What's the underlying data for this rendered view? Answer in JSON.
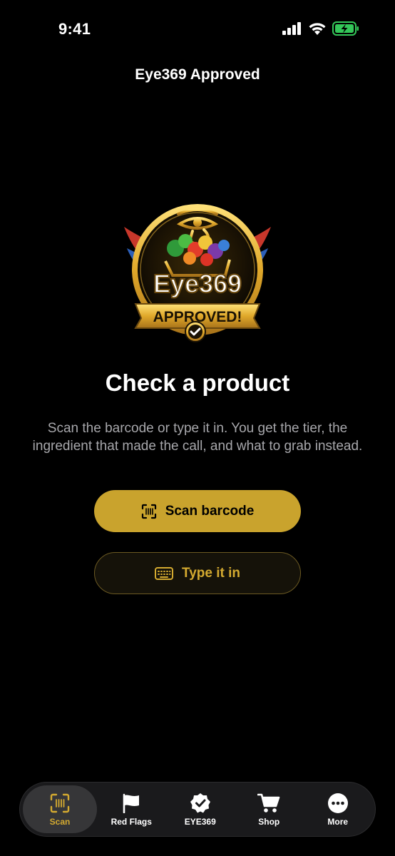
{
  "status_bar": {
    "time": "9:41"
  },
  "header": {
    "title": "Eye369 Approved"
  },
  "logo": {
    "brand": "Eye369",
    "banner": "APPROVED!"
  },
  "main": {
    "heading": "Check a product",
    "description": "Scan the barcode or type it in. You get the tier, the ingredient that made the call, and what to grab instead.",
    "scan_button": "Scan barcode",
    "type_button": "Type it in"
  },
  "tabs": [
    {
      "label": "Scan",
      "icon": "barcode-scan-icon",
      "active": true
    },
    {
      "label": "Red Flags",
      "icon": "flag-icon"
    },
    {
      "label": "EYE369",
      "icon": "verified-badge-icon"
    },
    {
      "label": "Shop",
      "icon": "cart-icon"
    },
    {
      "label": "More",
      "icon": "more-icon"
    }
  ],
  "colors": {
    "accent": "#c9a32d",
    "background": "#000000",
    "tab_bar": "#1a1a1c",
    "battery": "#34c759"
  }
}
